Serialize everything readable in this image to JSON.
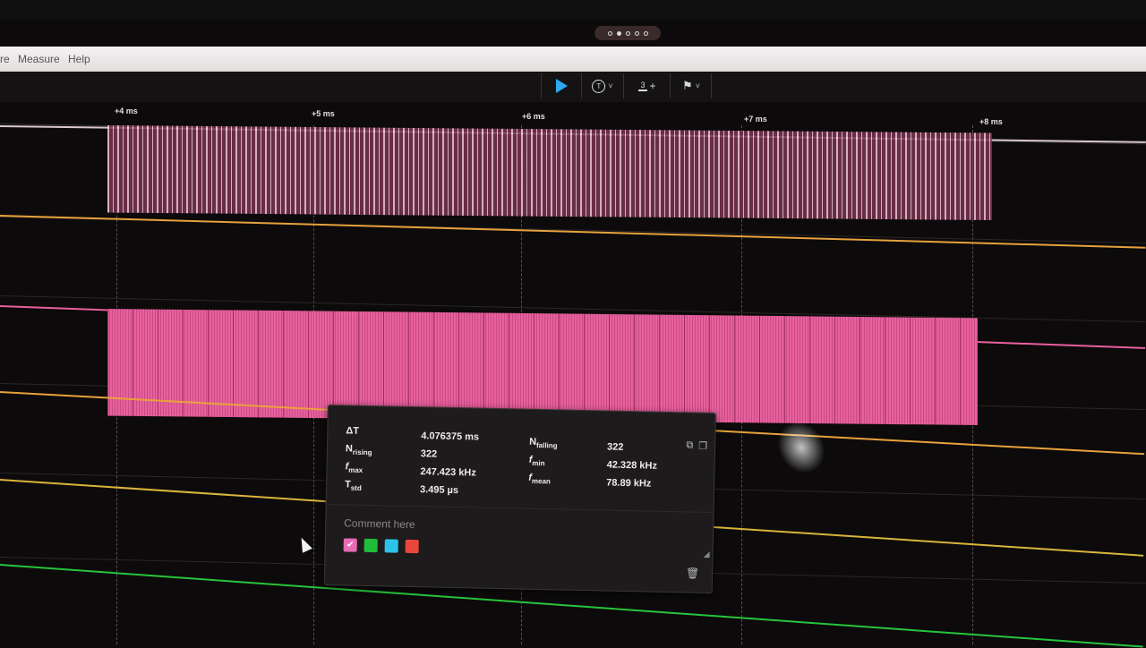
{
  "menu": {
    "items": [
      "re",
      "Measure",
      "Help"
    ]
  },
  "toolbar": {
    "trigger_glyph": "T",
    "measure_count": "3",
    "measure_plus": "+",
    "chevron": "˅"
  },
  "timeline": {
    "ticks": [
      "+4 ms",
      "+5 ms",
      "+6 ms",
      "+7 ms",
      "+8 ms"
    ]
  },
  "channels": {
    "colors": {
      "burst": "#e8609e",
      "orange": "#e8a13c",
      "pink_wire": "#e8609e",
      "yellow": "#d9b43c",
      "green": "#27c43c"
    }
  },
  "measurement": {
    "delta_t_label": "ΔT",
    "delta_t_value": "4.076375 ms",
    "n_rising_label": "N",
    "n_rising_sub": "rising",
    "n_rising_value": "322",
    "f_max_label": "f",
    "f_max_sub": "max",
    "f_max_value": "247.423 kHz",
    "t_std_label": "T",
    "t_std_sub": "std",
    "t_std_value": "3.495 µs",
    "n_falling_label": "N",
    "n_falling_sub": "falling",
    "n_falling_value": "322",
    "f_min_label": "f",
    "f_min_sub": "min",
    "f_min_value": "42.328 kHz",
    "f_mean_label": "f",
    "f_mean_sub": "mean",
    "f_mean_value": "78.89 kHz",
    "comment_placeholder": "Comment here",
    "color_options": [
      "#e86bb7",
      "#1fbd3a",
      "#2bc3e8",
      "#e8483b"
    ],
    "selected_color": "#e86bb7"
  }
}
